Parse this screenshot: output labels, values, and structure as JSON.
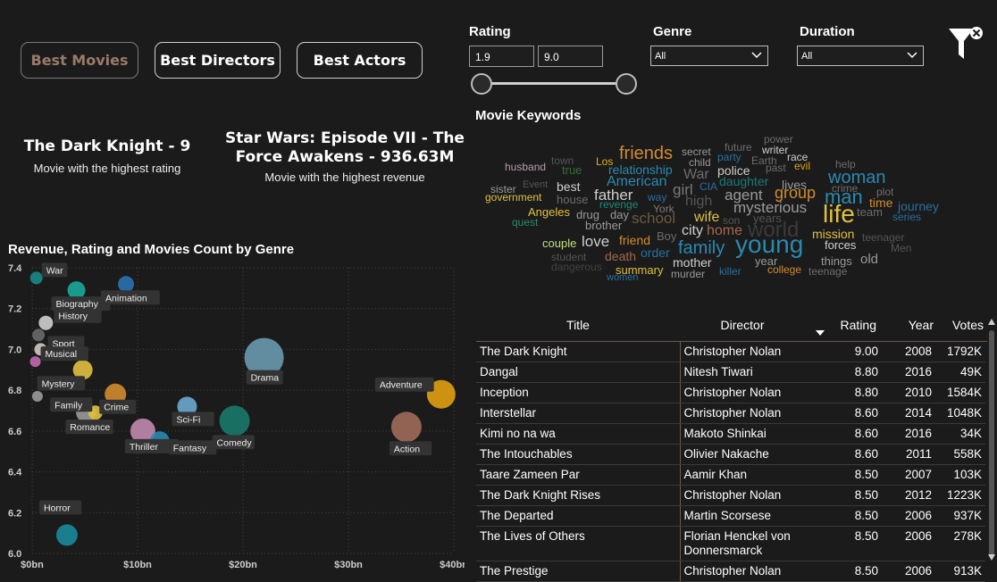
{
  "nav": {
    "best_movies": "Best Movies",
    "best_directors": "Best Directors",
    "best_actors": "Best Actors"
  },
  "filters": {
    "rating_label": "Rating",
    "rating_min": "1.9",
    "rating_max": "9.0",
    "genre_label": "Genre",
    "genre_value": "All",
    "duration_label": "Duration",
    "duration_value": "All"
  },
  "kpis": {
    "top_rated_title": "The Dark Knight - 9",
    "top_rated_sub": "Movie with the highest rating",
    "top_revenue_line1": "Star Wars: Episode VII - The",
    "top_revenue_line2": "Force Awakens - 936.63M",
    "top_revenue_sub": "Movie with the highest revenue"
  },
  "keywords": {
    "title": "Movie Keywords",
    "words": [
      {
        "t": "power",
        "s": 12,
        "c": "#6d6d6d"
      },
      {
        "t": "future",
        "s": 12,
        "c": "#6d6d6d"
      },
      {
        "t": "writer",
        "s": 12,
        "c": "#cfcfcf"
      },
      {
        "t": "secret",
        "s": 12,
        "c": "#9a9a9a"
      },
      {
        "t": "friends",
        "s": 20,
        "c": "#d28c2e"
      },
      {
        "t": "party",
        "s": 12,
        "c": "#2a6fa0"
      },
      {
        "t": "race",
        "s": 12,
        "c": "#cfcfcf"
      },
      {
        "t": "town",
        "s": 12,
        "c": "#555"
      },
      {
        "t": "child",
        "s": 12,
        "c": "#9a9a9a"
      },
      {
        "t": "Earth",
        "s": 12,
        "c": "#6d6d6d"
      },
      {
        "t": "husband",
        "s": 12,
        "c": "#b89ab3"
      },
      {
        "t": "Los",
        "s": 12,
        "c": "#e0b020"
      },
      {
        "t": "relationship",
        "s": 14,
        "c": "#2a8ab0"
      },
      {
        "t": "police",
        "s": 14,
        "c": "#cfcfcf"
      },
      {
        "t": "past",
        "s": 12,
        "c": "#6d6d6d"
      },
      {
        "t": "evil",
        "s": 12,
        "c": "#e0a010"
      },
      {
        "t": "help",
        "s": 12,
        "c": "#6d6d6d"
      },
      {
        "t": "true",
        "s": 13,
        "c": "#3a6b3a"
      },
      {
        "t": "War",
        "s": 16,
        "c": "#6d6d6d"
      },
      {
        "t": "woman",
        "s": 20,
        "c": "#2a8ab0"
      },
      {
        "t": "Event",
        "s": 11,
        "c": "#555"
      },
      {
        "t": "American",
        "s": 16,
        "c": "#2a8ab0"
      },
      {
        "t": "CIA",
        "s": 12,
        "c": "#2a6fa0"
      },
      {
        "t": "daughter",
        "s": 14,
        "c": "#1a7a7a"
      },
      {
        "t": "lives",
        "s": 14,
        "c": "#9a9a9a"
      },
      {
        "t": "sister",
        "s": 12,
        "c": "#9a9a9a"
      },
      {
        "t": "best",
        "s": 14,
        "c": "#cfcfcf"
      },
      {
        "t": "girl",
        "s": 17,
        "c": "#7a7a7a"
      },
      {
        "t": "crime",
        "s": 12,
        "c": "#6d6d6d"
      },
      {
        "t": "plot",
        "s": 12,
        "c": "#6d6d6d"
      },
      {
        "t": "government",
        "s": 12,
        "c": "#e0c040"
      },
      {
        "t": "father",
        "s": 17,
        "c": "#cfcfcf"
      },
      {
        "t": "agent",
        "s": 17,
        "c": "#9a9a9a"
      },
      {
        "t": "group",
        "s": 18,
        "c": "#d28c2e"
      },
      {
        "t": "man",
        "s": 22,
        "c": "#2a8ab0"
      },
      {
        "t": "house",
        "s": 13,
        "c": "#6d6d6d"
      },
      {
        "t": "way",
        "s": 12,
        "c": "#2a6fa0"
      },
      {
        "t": "high",
        "s": 16,
        "c": "#555"
      },
      {
        "t": "time",
        "s": 14,
        "c": "#d28c2e"
      },
      {
        "t": "revenge",
        "s": 12,
        "c": "#1a8a7a"
      },
      {
        "t": "York",
        "s": 12,
        "c": "#7a7a7a"
      },
      {
        "t": "mysterious",
        "s": 17,
        "c": "#9a9a9a"
      },
      {
        "t": "journey",
        "s": 14,
        "c": "#2a6fa0"
      },
      {
        "t": "Angeles",
        "s": 13,
        "c": "#e0c040"
      },
      {
        "t": "drug",
        "s": 13,
        "c": "#9a9a9a"
      },
      {
        "t": "day",
        "s": 13,
        "c": "#9a9a9a"
      },
      {
        "t": "school",
        "s": 17,
        "c": "#6d5a3a"
      },
      {
        "t": "son",
        "s": 12,
        "c": "#555"
      },
      {
        "t": "years",
        "s": 13,
        "c": "#555"
      },
      {
        "t": "life",
        "s": 28,
        "c": "#e0c040"
      },
      {
        "t": "team",
        "s": 13,
        "c": "#6d6d6d"
      },
      {
        "t": "series",
        "s": 12,
        "c": "#2a6fa0"
      },
      {
        "t": "quest",
        "s": 12,
        "c": "#2a8a6a"
      },
      {
        "t": "brother",
        "s": 13,
        "c": "#9a9a9a"
      },
      {
        "t": "wife",
        "s": 16,
        "c": "#e0c040"
      },
      {
        "t": "world",
        "s": 24,
        "c": "#3a3a3a"
      },
      {
        "t": "city",
        "s": 16,
        "c": "#cfcfcf"
      },
      {
        "t": "home",
        "s": 16,
        "c": "#a06a4a"
      },
      {
        "t": "Boy",
        "s": 13,
        "c": "#6d6d6d"
      },
      {
        "t": "mission",
        "s": 14,
        "c": "#e0c040"
      },
      {
        "t": "teenager",
        "s": 12,
        "c": "#555"
      },
      {
        "t": "couple",
        "s": 13,
        "c": "#c0e080"
      },
      {
        "t": "love",
        "s": 17,
        "c": "#cfcfcf"
      },
      {
        "t": "friend",
        "s": 14,
        "c": "#d28c2e"
      },
      {
        "t": "family",
        "s": 20,
        "c": "#2a8ab0"
      },
      {
        "t": "young",
        "s": 28,
        "c": "#2a8ab0"
      },
      {
        "t": "forces",
        "s": 13,
        "c": "#cfcfcf"
      },
      {
        "t": "Men",
        "s": 12,
        "c": "#555"
      },
      {
        "t": "student",
        "s": 12,
        "c": "#555"
      },
      {
        "t": "order",
        "s": 14,
        "c": "#2a6fa0"
      },
      {
        "t": "death",
        "s": 14,
        "c": "#a06a4a"
      },
      {
        "t": "year",
        "s": 13,
        "c": "#9a9a9a"
      },
      {
        "t": "things",
        "s": 13,
        "c": "#9a9a9a"
      },
      {
        "t": "old",
        "s": 15,
        "c": "#9a9a9a"
      },
      {
        "t": "dangerous",
        "s": 12,
        "c": "#444"
      },
      {
        "t": "mother",
        "s": 14,
        "c": "#cfcfcf"
      },
      {
        "t": "summary",
        "s": 13,
        "c": "#e0c040"
      },
      {
        "t": "college",
        "s": 12,
        "c": "#d28c2e"
      },
      {
        "t": "murder",
        "s": 12,
        "c": "#9a9a9a"
      },
      {
        "t": "killer",
        "s": 12,
        "c": "#2a6fa0"
      },
      {
        "t": "teenage",
        "s": 12,
        "c": "#6d6d6d"
      },
      {
        "t": "women",
        "s": 11,
        "c": "#2a6fa0"
      }
    ]
  },
  "chart_title": "Revenue, Rating and Movies Count by Genre",
  "chart_data": {
    "type": "scatter",
    "title": "Revenue, Rating and Movies Count by Genre",
    "xlabel": "",
    "ylabel": "",
    "xlim": [
      0,
      40
    ],
    "ylim": [
      6.0,
      7.4
    ],
    "x_ticks": [
      "$0bn",
      "$10bn",
      "$20bn",
      "$30bn",
      "$40bn"
    ],
    "y_ticks": [
      "6.0",
      "6.2",
      "6.4",
      "6.6",
      "6.8",
      "7.0",
      "7.2",
      "7.4"
    ],
    "grid": true,
    "points": [
      {
        "name": "War",
        "x": 0.4,
        "y": 7.35,
        "r": 7,
        "color": "#1a8a8a"
      },
      {
        "name": "Biography",
        "x": 4.2,
        "y": 7.29,
        "r": 10,
        "color": "#1aa89a"
      },
      {
        "name": "Animation",
        "x": 8.9,
        "y": 7.32,
        "r": 9,
        "color": "#2a72b0"
      },
      {
        "name": "History",
        "x": 1.3,
        "y": 7.13,
        "r": 8,
        "color": "#cfcfcf"
      },
      {
        "name": "",
        "x": 0.6,
        "y": 7.07,
        "r": 7,
        "color": "#6a6a6a"
      },
      {
        "name": "Sport",
        "x": 0.8,
        "y": 7.0,
        "r": 7,
        "color": "#d0c8c0"
      },
      {
        "name": "Musical",
        "x": 0.3,
        "y": 6.94,
        "r": 6,
        "color": "#c06ab0"
      },
      {
        "name": "Mystery",
        "x": 4.8,
        "y": 6.9,
        "r": 11,
        "color": "#e0c040"
      },
      {
        "name": "",
        "x": 0.5,
        "y": 6.77,
        "r": 6,
        "color": "#9a9a9a"
      },
      {
        "name": "Crime",
        "x": 7.9,
        "y": 6.78,
        "r": 12,
        "color": "#d28c2e"
      },
      {
        "name": "Family",
        "x": 5.1,
        "y": 6.69,
        "r": 11,
        "color": "#9a9a9a"
      },
      {
        "name": "",
        "x": 6.0,
        "y": 6.69,
        "r": 8,
        "color": "#e0c040"
      },
      {
        "name": "Sci-Fi",
        "x": 14.7,
        "y": 6.72,
        "r": 11,
        "color": "#6aaad0"
      },
      {
        "name": "Drama",
        "x": 22.0,
        "y": 6.96,
        "r": 22,
        "color": "#6a9ab0"
      },
      {
        "name": "Adventure",
        "x": 38.8,
        "y": 6.78,
        "r": 16,
        "color": "#e0a010"
      },
      {
        "name": "Comedy",
        "x": 19.2,
        "y": 6.65,
        "r": 17,
        "color": "#1a7a6a"
      },
      {
        "name": "Thriller",
        "x": 10.5,
        "y": 6.6,
        "r": 14,
        "color": "#c08ab0"
      },
      {
        "name": "Fantasy",
        "x": 12.1,
        "y": 6.55,
        "r": 11,
        "color": "#2a8ab0"
      },
      {
        "name": "Action",
        "x": 35.5,
        "y": 6.62,
        "r": 17,
        "color": "#a06a5a"
      },
      {
        "name": "Horror",
        "x": 3.3,
        "y": 6.09,
        "r": 12,
        "color": "#1a8a9a"
      }
    ]
  },
  "chart_labels": {
    "War": {
      "dx": 10,
      "dy": -6
    },
    "Biography": {
      "dx": -24,
      "dy": 18
    },
    "Animation": {
      "dx": -24,
      "dy": 18
    },
    "History": {
      "dx": 13,
      "dy": -5
    },
    "Sport": {
      "dx": 12,
      "dy": -4
    },
    "Musical": {
      "dx": 10,
      "dy": -6
    },
    "Mystery": {
      "dx": -47,
      "dy": 18
    },
    "Crime": {
      "dx": -14,
      "dy": 17
    },
    "Family": {
      "dx": -36,
      "dy": -6
    },
    "Sci-Fi": {
      "dx": -13,
      "dy": 17
    },
    "Drama": {
      "dx": -16,
      "dy": 25
    },
    "Adventure": {
      "dx": -70,
      "dy": -8
    },
    "Comedy": {
      "dx": -21,
      "dy": 27
    },
    "Thriller": {
      "dx": -16,
      "dy": 20
    },
    "Fantasy": {
      "dx": 14,
      "dy": 10
    },
    "Action": {
      "dx": -15,
      "dy": 27
    },
    "Horror": {
      "dx": -27,
      "dy": -28
    }
  },
  "table": {
    "headers": [
      "Title",
      "Director",
      "Rating",
      "Year",
      "Votes"
    ],
    "rows": [
      [
        "The Dark Knight",
        "Christopher Nolan",
        "9.00",
        "2008",
        "1792K"
      ],
      [
        "Dangal",
        "Nitesh Tiwari",
        "8.80",
        "2016",
        "49K"
      ],
      [
        "Inception",
        "Christopher Nolan",
        "8.80",
        "2010",
        "1584K"
      ],
      [
        "Interstellar",
        "Christopher Nolan",
        "8.60",
        "2014",
        "1048K"
      ],
      [
        "Kimi no na wa",
        "Makoto Shinkai",
        "8.60",
        "2016",
        "34K"
      ],
      [
        "The Intouchables",
        "Olivier Nakache",
        "8.60",
        "2011",
        "558K"
      ],
      [
        "Taare Zameen Par",
        "Aamir Khan",
        "8.50",
        "2007",
        "103K"
      ],
      [
        "The Dark Knight Rises",
        "Christopher Nolan",
        "8.50",
        "2012",
        "1223K"
      ],
      [
        "The Departed",
        "Martin Scorsese",
        "8.50",
        "2006",
        "937K"
      ],
      [
        "The Lives of Others",
        "Florian Henckel von Donnersmarck",
        "8.50",
        "2006",
        "278K"
      ],
      [
        "The Prestige",
        "Christopher Nolan",
        "8.50",
        "2006",
        "913K"
      ]
    ]
  },
  "extra_labels": {
    "romance": "Romance"
  },
  "colors": {
    "background": "#1b1b1b",
    "accent": "#9a7a68"
  }
}
